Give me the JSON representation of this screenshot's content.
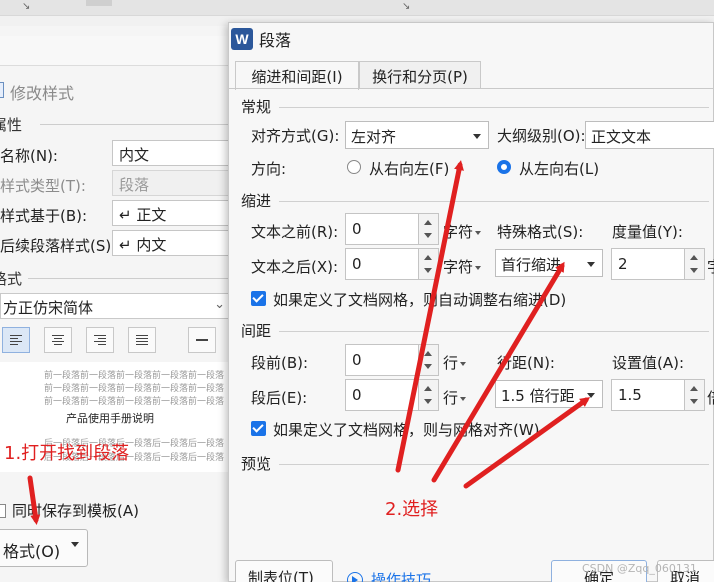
{
  "background_dialog": {
    "title": "修改样式",
    "properties_heading": "属性",
    "name_label": "名称(N):",
    "name_value": "内文",
    "style_type_label": "样式类型(T):",
    "style_type_value": "段落",
    "based_on_label": "样式基于(B):",
    "based_on_value": "↵ 正文",
    "next_style_label": "后续段落样式(S):",
    "next_style_value": "↵ 内文",
    "format_heading": "格式",
    "font_value": "方正仿宋简体",
    "preview_lines": [
      "前一段落前一段落前一段落前一段落前一段落",
      "前一段落前一段落前一段落前一段落前一段落",
      "前一段落前一段落前一段落前一段落前一段落"
    ],
    "preview_title": "产品使用手册说明",
    "preview_after_lines": [
      "后一段落后一段落后一段落后一段落后一段落",
      "后一段落后一段落后一段落后一段落后一段落"
    ],
    "save_template_label": "同时保存到模板(A)",
    "format_button": "格式(O)"
  },
  "dialog": {
    "title": "段落",
    "logo": "W",
    "tabs": [
      {
        "label": "缩进和间距(I)",
        "active": true
      },
      {
        "label": "换行和分页(P)",
        "active": false
      }
    ],
    "general": {
      "heading": "常规",
      "alignment_label": "对齐方式(G):",
      "alignment_value": "左对齐",
      "outline_label": "大纲级别(O):",
      "outline_value": "正文文本",
      "direction_label": "方向:",
      "rtl_label": "从右向左(F)",
      "ltr_label": "从左向右(L)",
      "direction_selected": "ltr"
    },
    "indent": {
      "heading": "缩进",
      "before_label": "文本之前(R):",
      "before_value": "0",
      "before_unit": "字符",
      "after_label": "文本之后(X):",
      "after_value": "0",
      "after_unit": "字符",
      "special_label": "特殊格式(S):",
      "special_value": "首行缩进",
      "measure_label": "度量值(Y):",
      "measure_value": "2",
      "measure_unit": "字",
      "grid_checkbox": "如果定义了文档网格，则自动调整右缩进(D)",
      "grid_checked": true
    },
    "spacing": {
      "heading": "间距",
      "before_label": "段前(B):",
      "before_value": "0",
      "before_unit": "行",
      "after_label": "段后(E):",
      "after_value": "0",
      "after_unit": "行",
      "line_label": "行距(N):",
      "line_value": "1.5 倍行距",
      "setting_label": "设置值(A):",
      "setting_value": "1.5",
      "setting_unit": "倍",
      "grid_checkbox": "如果定义了文档网格，则与网格对齐(W)",
      "grid_checked": true
    },
    "preview_heading": "预览",
    "footer": {
      "tabs_button": "制表位(T)",
      "tips_label": "操作技巧",
      "ok_button": "确定",
      "cancel_button": "取消"
    }
  },
  "annotations": {
    "step1": "1.打开找到段落",
    "step2": "2.选择",
    "color": "#e02020"
  },
  "watermark": "CSDN @Zqq_060131",
  "colors": {
    "accent": "#1a73e8",
    "word_blue": "#2b579a",
    "annotation_red": "#e02020"
  }
}
